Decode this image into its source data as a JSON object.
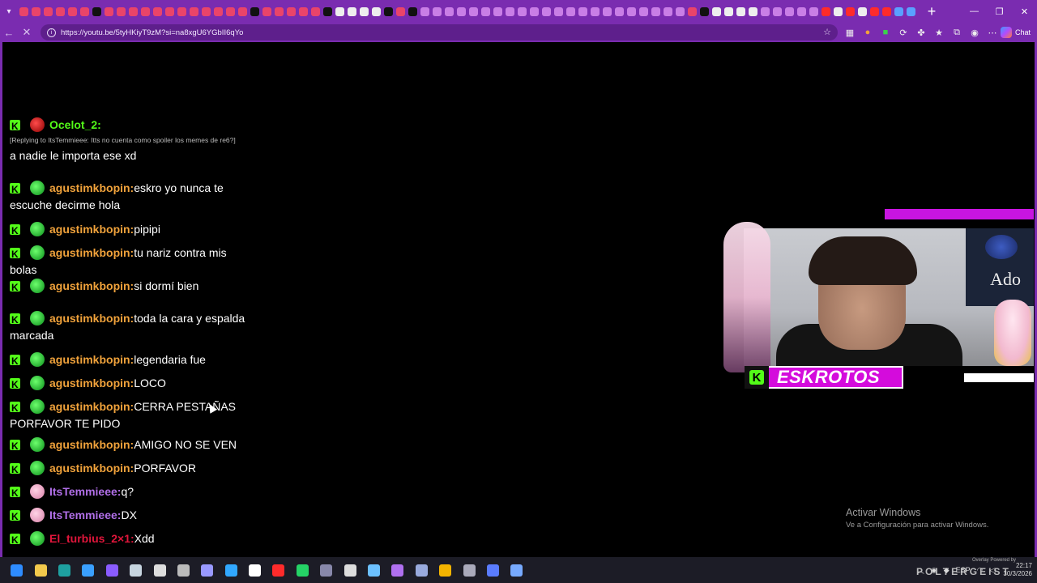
{
  "browser": {
    "url": "https://youtu.be/5tyHKiyT9zM?si=na8xgU6YGbII6qYo",
    "chat_label": "Chat",
    "colors": {
      "frame": "#7a2cb0",
      "kick_green": "#53fc18"
    }
  },
  "chat": {
    "messages": [
      {
        "user": "Ocelot_2:",
        "color": "#53fc18",
        "reply": "[Replying to ItsTemmieee: Itts no cuenta como spoiler los memes de re6?]",
        "text": "a nadie le importa ese xd"
      },
      {
        "user": "agustimkbopin:",
        "color": "#f0a23b",
        "text": "eskro yo nunca te",
        "text2": "escuche decirme hola"
      },
      {
        "user": "agustimkbopin:",
        "color": "#f0a23b",
        "text": "pipipi"
      },
      {
        "user": "agustimkbopin:",
        "color": "#f0a23b",
        "text": "tu nariz contra mis",
        "text2": "bolas"
      },
      {
        "user": "agustimkbopin:",
        "color": "#f0a23b",
        "text": "si dormí bien"
      },
      {
        "user": "agustimkbopin:",
        "color": "#f0a23b",
        "text": "toda la cara y espalda",
        "text2": "marcada"
      },
      {
        "user": "agustimkbopin:",
        "color": "#f0a23b",
        "text": "legendaria fue"
      },
      {
        "user": "agustimkbopin:",
        "color": "#f0a23b",
        "text": "LOCO"
      },
      {
        "user": "agustimkbopin:",
        "color": "#f0a23b",
        "text": "CERRA PESTAÑAS",
        "text2": "PORFAVOR TE PIDO"
      },
      {
        "user": "agustimkbopin:",
        "color": "#f0a23b",
        "text": "AMIGO NO SE VEN"
      },
      {
        "user": "agustimkbopin:",
        "color": "#f0a23b",
        "text": "PORFAVOR"
      },
      {
        "user": "ItsTemmieee:",
        "color": "#b16fe8",
        "text": "q?"
      },
      {
        "user": "ItsTemmieee:",
        "color": "#b16fe8",
        "text": "DX"
      },
      {
        "user": "El_turbius_2×1:",
        "color": "#e0163b",
        "text": "Xdd"
      }
    ]
  },
  "stream": {
    "streamer_name": "ESKROTOS",
    "poster_text": "Ado"
  },
  "watermark": {
    "line1": "Activar Windows",
    "line2": "Ve a Configuración para activar Windows."
  },
  "taskbar": {
    "overlay_text": "POLTERGEIST",
    "language": "ESP",
    "time": "22:17",
    "date": "30/3/2026",
    "overlay_note": "Overlay Powered by"
  }
}
